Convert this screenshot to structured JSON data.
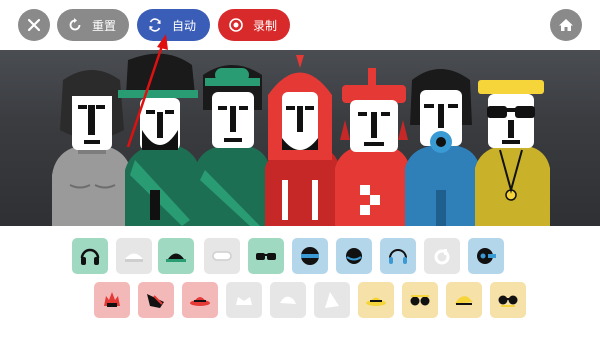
{
  "toolbar": {
    "reset_label": "重置",
    "auto_label": "自动",
    "record_label": "录制"
  },
  "icons": {
    "close": "close-icon",
    "reset": "refresh-icon",
    "auto": "sync-icon",
    "record": "record-icon",
    "home": "home-icon"
  },
  "colors": {
    "toolbar_gray": "#8a8a8a",
    "auto_blue": "#3a5db8",
    "record_red": "#d82a2a",
    "beats_green": "#9fd9c2",
    "effects_gray": "#e6e6e6",
    "melodies_blue": "#b4d6ea",
    "voices_red": "#f3b8b8",
    "voices_yellow": "#f6e2a8"
  },
  "characters": [
    "gray",
    "green",
    "green",
    "red",
    "red",
    "blue",
    "yellow"
  ],
  "sounds_row1": [
    "headphones",
    "cap",
    "cap",
    "goggles",
    "glasses",
    "visor",
    "hat",
    "headphones",
    "accessory",
    "speaker"
  ],
  "sounds_row2": [
    "hair",
    "hair",
    "fedora",
    "crown",
    "cap",
    "hood",
    "hat",
    "glasses",
    "hat",
    "glasses"
  ]
}
